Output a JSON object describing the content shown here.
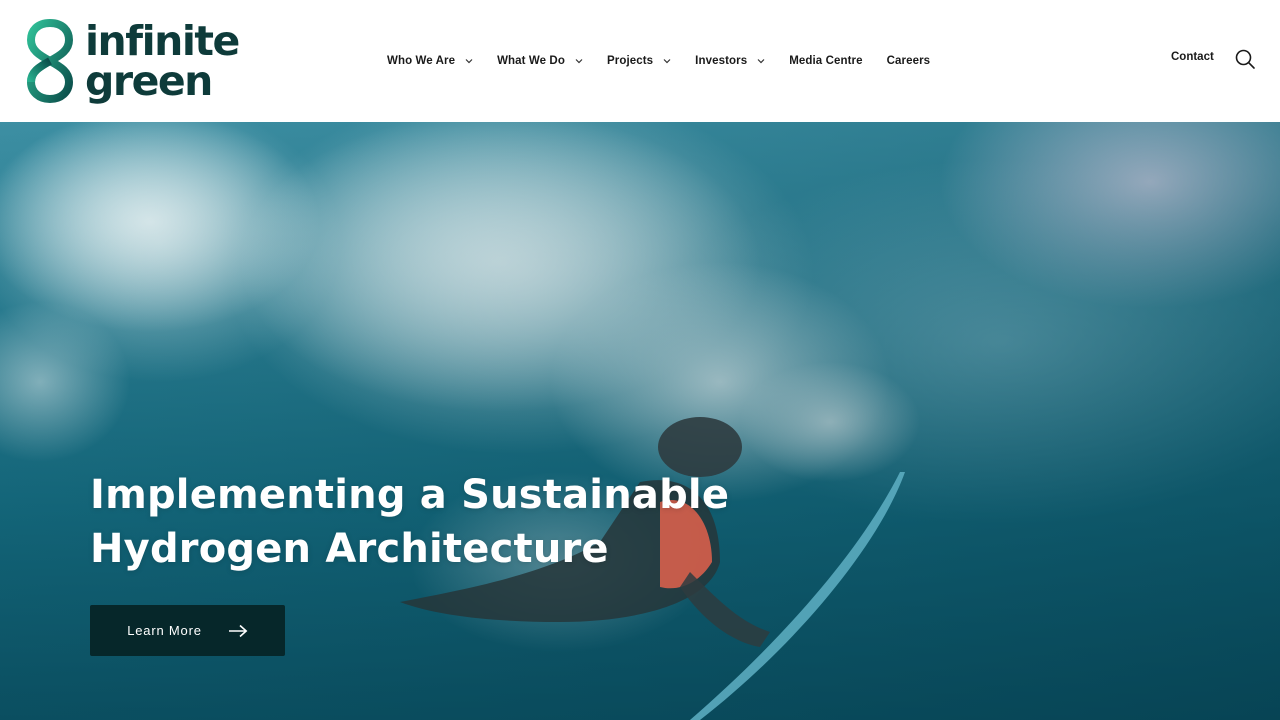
{
  "brand": {
    "line1": "infinite",
    "line2": "green",
    "colors": {
      "dark": "#0e3b3a",
      "gradient_start": "#1ea98b",
      "gradient_end": "#0d5a54"
    }
  },
  "nav": {
    "items": [
      {
        "label": "Who We Are",
        "has_dropdown": true
      },
      {
        "label": "What We Do",
        "has_dropdown": true
      },
      {
        "label": "Projects",
        "has_dropdown": true
      },
      {
        "label": "Investors",
        "has_dropdown": true
      },
      {
        "label": "Media Centre",
        "has_dropdown": false
      },
      {
        "label": "Careers",
        "has_dropdown": false
      }
    ],
    "contact_label": "Contact",
    "search_icon": "search-icon"
  },
  "hero": {
    "title_line1": "Implementing a Sustainable",
    "title_line2": "Hydrogen Architecture",
    "cta_label": "Learn More",
    "cta_icon": "arrow-right-icon",
    "cta_color": "#06272a"
  }
}
